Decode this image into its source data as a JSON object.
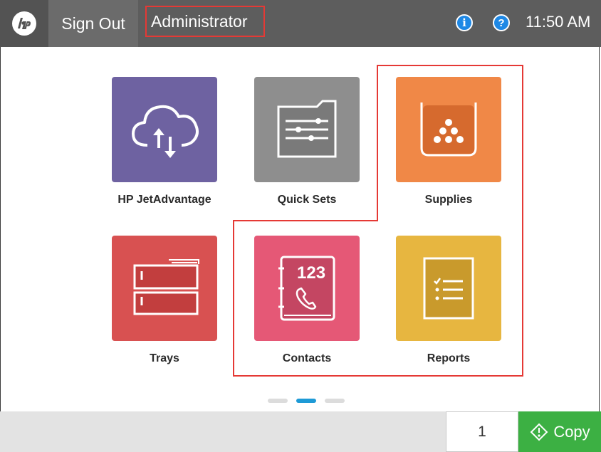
{
  "header": {
    "logo": "hp-logo",
    "sign_out": "Sign Out",
    "user": "Administrator",
    "info_glyph": "i",
    "help_glyph": "?",
    "time": "11:50 AM"
  },
  "tiles": [
    {
      "label": "HP JetAdvantage",
      "icon": "cloud-sync-icon",
      "color": "#6e62a1"
    },
    {
      "label": "Quick Sets",
      "icon": "folder-sliders-icon",
      "color": "#8e8e8e"
    },
    {
      "label": "Supplies",
      "icon": "toner-icon",
      "color": "#f08847"
    },
    {
      "label": "Trays",
      "icon": "trays-icon",
      "color": "#d85151"
    },
    {
      "label": "Contacts",
      "icon": "address-book-icon",
      "color": "#e55876",
      "book_text": "123"
    },
    {
      "label": "Reports",
      "icon": "report-checklist-icon",
      "color": "#e7b640"
    }
  ],
  "pager": {
    "pages": 3,
    "active": 2,
    "active_color": "#1e9ad6",
    "inactive_color": "#dcdcdc"
  },
  "footer": {
    "copies": "1",
    "copy_label": "Copy",
    "copy_color": "#3cb043"
  },
  "highlight_color": "#e53935"
}
